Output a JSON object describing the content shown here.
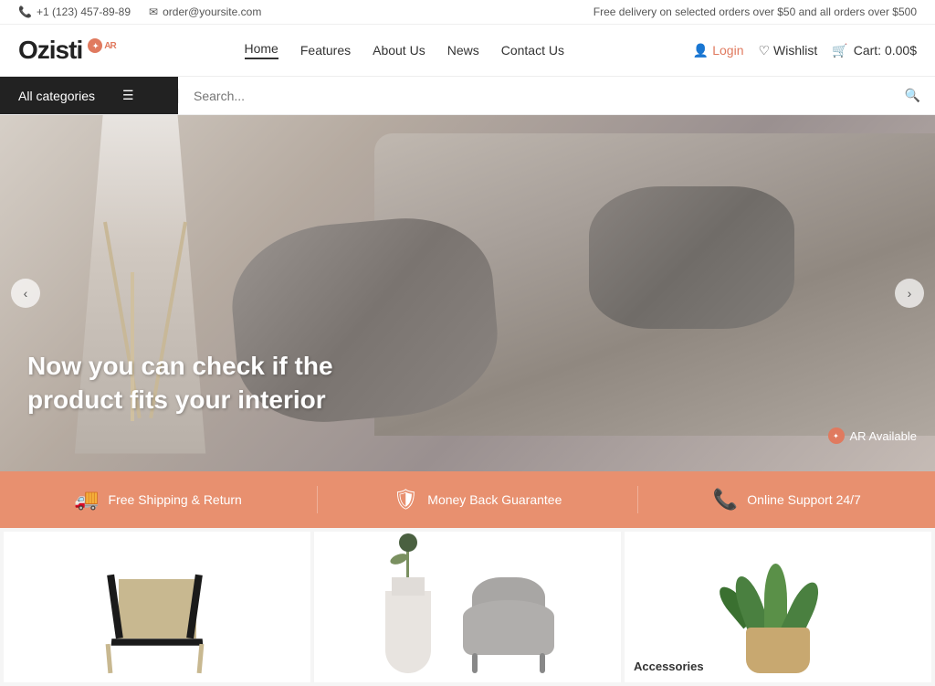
{
  "topbar": {
    "phone": "+1 (123) 457-89-89",
    "email": "order@yoursite.com",
    "promo": "Free delivery on selected orders over $50 and all orders over $500"
  },
  "header": {
    "logo": "Ozisti",
    "logo_ar": "AR",
    "nav": [
      {
        "label": "Home",
        "active": true
      },
      {
        "label": "Features"
      },
      {
        "label": "About Us"
      },
      {
        "label": "News"
      },
      {
        "label": "Contact Us"
      }
    ],
    "login": "Login",
    "wishlist": "Wishlist",
    "cart": "Cart: 0.00$"
  },
  "search": {
    "categories_label": "All categories",
    "placeholder": "Search..."
  },
  "hero": {
    "title": "Now you can check if the product fits your interior",
    "ar_badge": "AR Available",
    "nav_left": "‹",
    "nav_right": "›"
  },
  "features": [
    {
      "icon": "🚚",
      "label": "Free Shipping & Return"
    },
    {
      "icon": "🛡",
      "label": "Money Back Guarantee"
    },
    {
      "icon": "📞",
      "label": "Online Support 24/7"
    }
  ],
  "products": [
    {
      "label": "",
      "type": "chair"
    },
    {
      "label": "",
      "type": "vase-gray-chair"
    },
    {
      "label": "Accessories",
      "type": "plant"
    }
  ]
}
